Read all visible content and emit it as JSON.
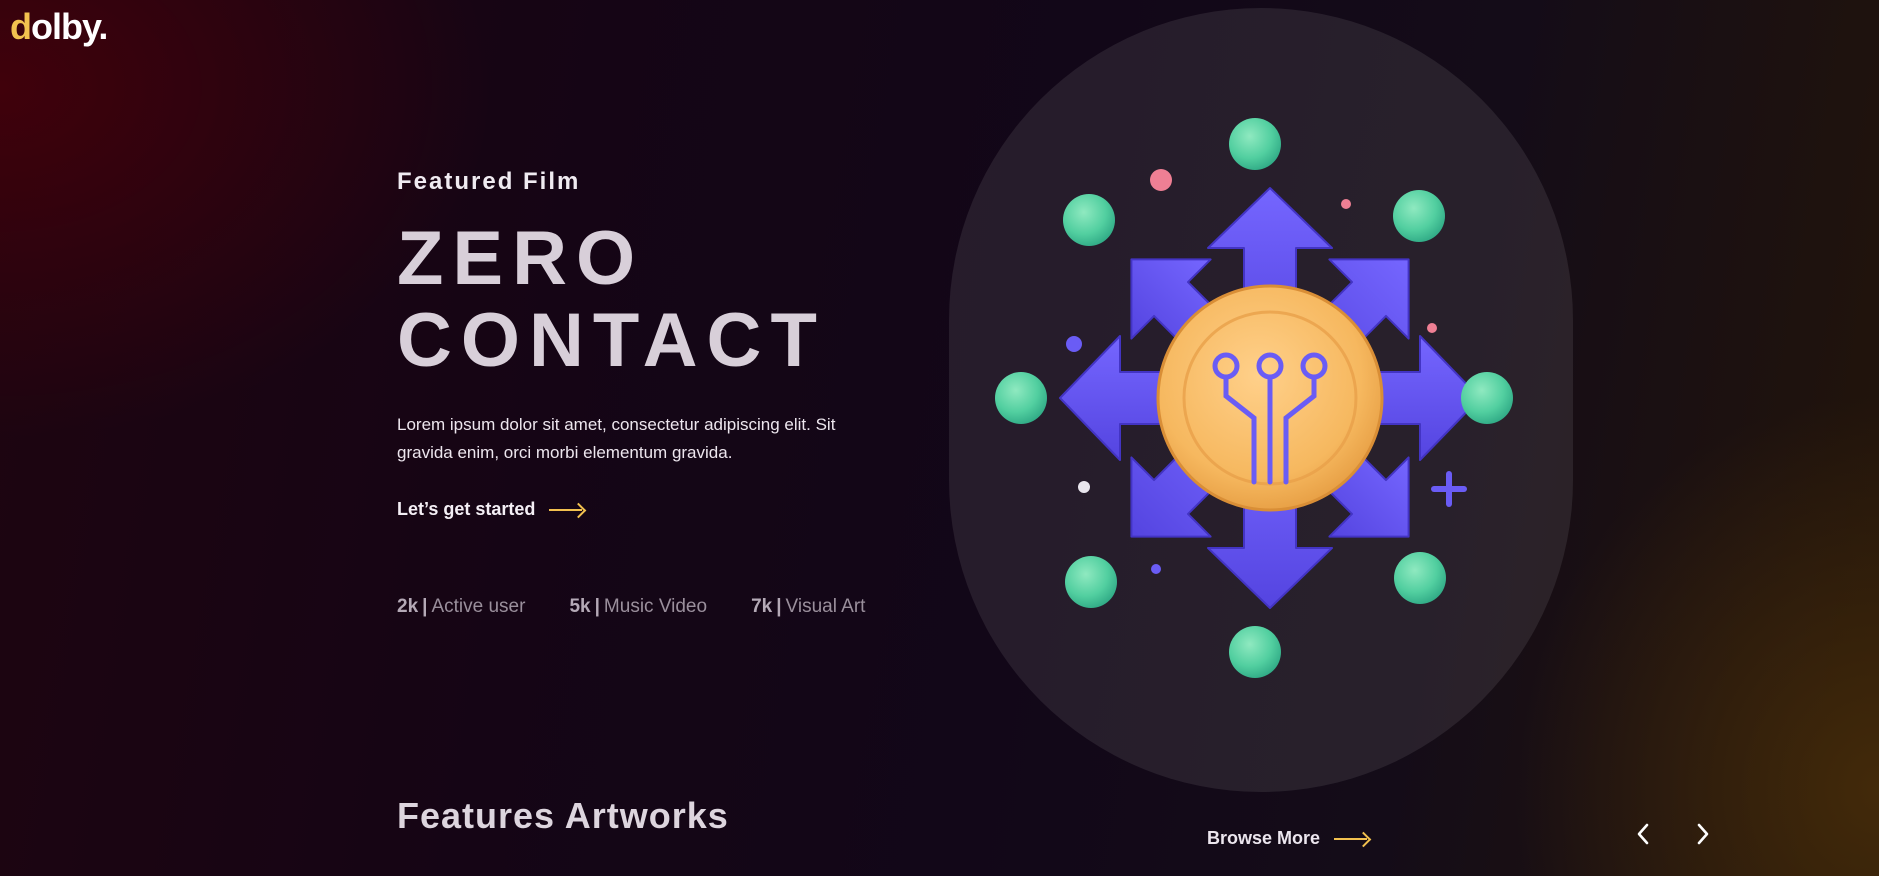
{
  "brand": {
    "logo_first": "d",
    "logo_rest": "olby."
  },
  "hero": {
    "eyebrow": "Featured Film",
    "title_line1": "ZERO",
    "title_line2": "CONTACT",
    "description": "Lorem ipsum dolor sit amet, consectetur adipiscing elit. Sit gravida enim, orci morbi elementum gravida.",
    "cta_label": "Let’s get started"
  },
  "stats": [
    {
      "value": "2k",
      "label": "Active user"
    },
    {
      "value": "5k",
      "label": "Music Video"
    },
    {
      "value": "7k",
      "label": "Visual Art"
    }
  ],
  "features": {
    "title": "Features Artworks",
    "browse_label": "Browse More"
  },
  "icons": {
    "arrow": "long-right-arrow-icon",
    "prev": "chevron-left-icon",
    "next": "chevron-right-icon",
    "hero_art": "network-hub-illustration"
  },
  "colors": {
    "accent": "#f2c14f",
    "arrow_purple": "#6a5cf5",
    "node_green": "#5ed6a0",
    "coin_orange": "#f7c06d"
  }
}
